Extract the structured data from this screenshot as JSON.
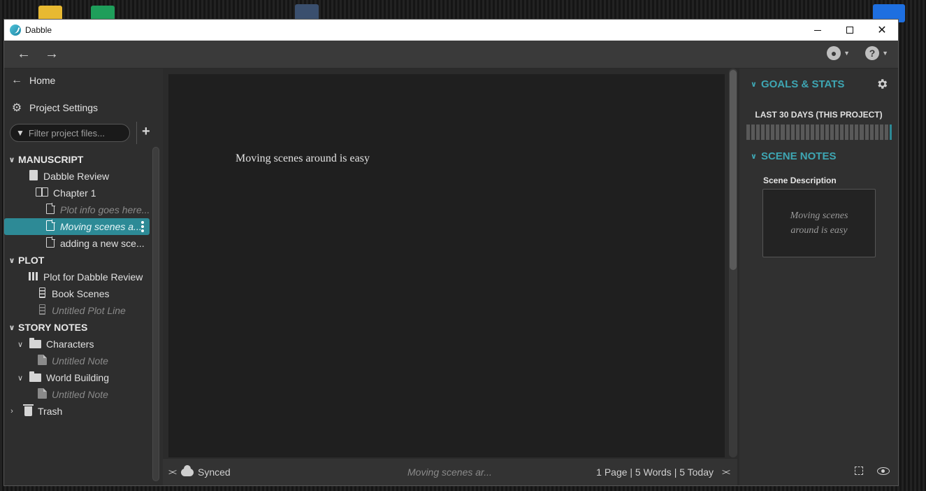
{
  "window": {
    "title": "Dabble"
  },
  "toolbar": {
    "back_glyph": "←",
    "forward_glyph": "→",
    "account_icon": "account-circle-icon",
    "help_icon": "help-circle-icon"
  },
  "sidebar": {
    "home_label": "Home",
    "settings_label": "Project Settings",
    "filter_placeholder": "Filter project files...",
    "add_glyph": "+",
    "tree": {
      "manuscript": "MANUSCRIPT",
      "book": "Dabble Review",
      "chapter": "Chapter 1",
      "scene1": "Plot info goes here...",
      "scene2": "Moving scenes a...",
      "scene3": "adding a new sce...",
      "plot": "PLOT",
      "plot_board": "Plot for Dabble Review",
      "plot_line1": "Book Scenes",
      "plot_line2": "Untitled Plot Line",
      "story_notes": "STORY NOTES",
      "folder1": "Characters",
      "note1": "Untitled Note",
      "folder2": "World Building",
      "note2": "Untitled Note",
      "trash": "Trash"
    }
  },
  "editor": {
    "content": "Moving scenes around is easy"
  },
  "statusbar": {
    "collapse_glyph": "><",
    "sync_label": "Synced",
    "doc_title": "Moving scenes ar...",
    "stats": "1 Page | 5 Words | 5 Today",
    "expand_glyph": "><"
  },
  "rightpanel": {
    "goals_title": "GOALS & STATS",
    "goals_subtitle": "LAST 30 DAYS (THIS PROJECT)",
    "scene_notes_title": "SCENE NOTES",
    "scene_description_label": "Scene Description",
    "scene_description": "Moving scenes around is easy"
  },
  "colors": {
    "accent": "#3ea6b3",
    "selection": "#2d8a96",
    "background": "#303030"
  }
}
